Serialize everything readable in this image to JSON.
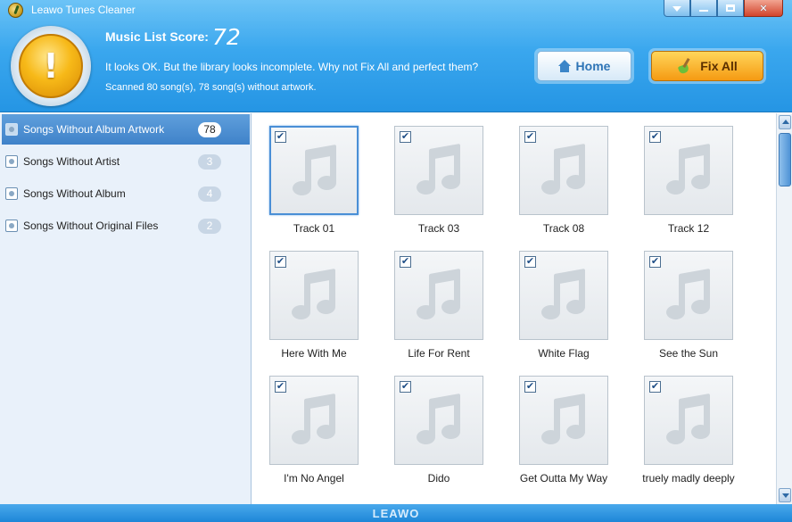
{
  "window": {
    "title": "Leawo Tunes Cleaner"
  },
  "header": {
    "score_label": "Music List Score:",
    "score_value": "72",
    "message": "It looks OK. But the library looks incomplete. Why not Fix All and perfect them?",
    "scan_summary": "Scanned 80 song(s), 78 song(s) without artwork.",
    "home_button": "Home",
    "fix_all_button": "Fix All"
  },
  "sidebar": {
    "items": [
      {
        "label": "Songs Without Album Artwork",
        "count": "78"
      },
      {
        "label": "Songs Without Artist",
        "count": "3"
      },
      {
        "label": "Songs Without Album",
        "count": "4"
      },
      {
        "label": "Songs Without Original Files",
        "count": "2"
      }
    ]
  },
  "tracks": [
    {
      "title": "Track 01",
      "checked": true
    },
    {
      "title": "Track 03",
      "checked": true
    },
    {
      "title": "Track 08",
      "checked": true
    },
    {
      "title": "Track 12",
      "checked": true
    },
    {
      "title": "Here With Me",
      "checked": true
    },
    {
      "title": "Life For Rent",
      "checked": true
    },
    {
      "title": "White Flag",
      "checked": true
    },
    {
      "title": "See the Sun",
      "checked": true
    },
    {
      "title": "I'm No Angel",
      "checked": true
    },
    {
      "title": "Dido",
      "checked": true
    },
    {
      "title": "Get Outta My Way",
      "checked": true
    },
    {
      "title": "truely madly deeply",
      "checked": true
    }
  ],
  "footer": {
    "brand": "LEAWO"
  },
  "colors": {
    "header": "#3aa7ee",
    "sidebar_active": "#4a8bd0",
    "fix_button": "#f5a623",
    "footer": "#1d86d8"
  }
}
